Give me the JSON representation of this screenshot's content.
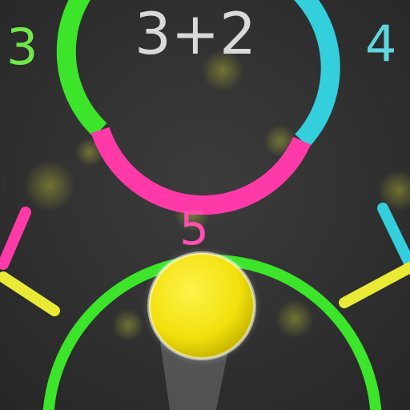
{
  "equation": "3+2",
  "answer": "5",
  "side_numbers": {
    "left": "3",
    "right": "4"
  },
  "colors": {
    "background": "#2f2f2f",
    "green": "#3ce42a",
    "pink": "#ff3aa8",
    "cyan": "#33cfdc",
    "yellow": "#e8ea35",
    "ball": "#f6e814"
  }
}
